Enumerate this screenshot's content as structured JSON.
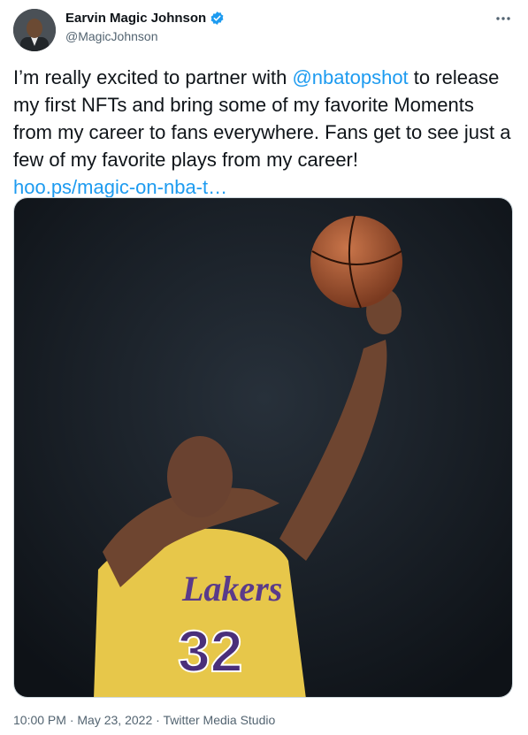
{
  "author": {
    "display_name": "Earvin Magic Johnson",
    "handle": "@MagicJohnson",
    "verified": true
  },
  "tweet": {
    "text_before": "I’m really excited to partner with ",
    "mention": "@nbatopshot",
    "text_after": " to release my first NFTs and bring some of my favorite Moments from my career to fans everywhere. Fans get to see just a few of my favorite plays from my career!",
    "link": "hoo.ps/magic-on-nba-t…"
  },
  "media": {
    "jersey_team": "Lakers",
    "jersey_number": "32"
  },
  "meta": {
    "time": "10:00 PM",
    "separator": " · ",
    "date": "May 23, 2022",
    "source": "Twitter Media Studio"
  },
  "icons": {
    "verified": "verified-badge-icon",
    "more": "more-options-icon"
  },
  "colors": {
    "link": "#1d9bf0",
    "secondary_text": "#536471",
    "primary_text": "#0f1419",
    "jersey": "#e7c74a"
  }
}
